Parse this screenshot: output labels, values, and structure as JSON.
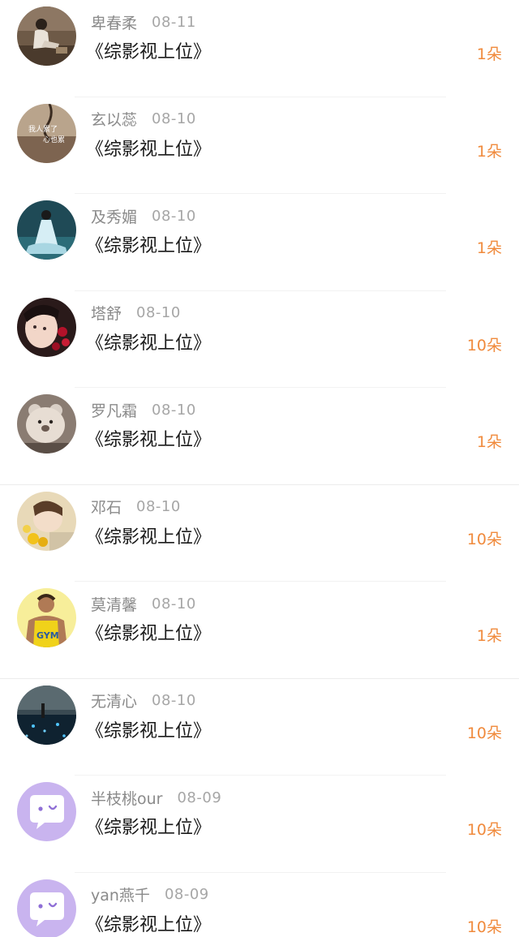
{
  "rows": [
    {
      "name": "卑春柔",
      "date": "08-11",
      "title": "《综影视上位》",
      "count": "1朵",
      "avatar": "girl-sitting-photo",
      "divider": "inset"
    },
    {
      "name": "玄以蕊",
      "date": "08-10",
      "title": "《综影视上位》",
      "count": "1朵",
      "avatar": "text-photo",
      "avatar_text": "我人累了 心也累",
      "divider": "inset"
    },
    {
      "name": "及秀媚",
      "date": "08-10",
      "title": "《综影视上位》",
      "count": "1朵",
      "avatar": "blue-dress-photo",
      "divider": "inset"
    },
    {
      "name": "塔舒",
      "date": "08-10",
      "title": "《综影视上位》",
      "count": "10朵",
      "avatar": "face-roses-photo",
      "divider": "inset"
    },
    {
      "name": "罗凡霜",
      "date": "08-10",
      "title": "《综影视上位》",
      "count": "1朵",
      "avatar": "bear-photo",
      "divider": "full"
    },
    {
      "name": "邓石",
      "date": "08-10",
      "title": "《综影视上位》",
      "count": "10朵",
      "avatar": "girl-flowers-photo",
      "divider": "inset"
    },
    {
      "name": "莫清馨",
      "date": "08-10",
      "title": "《综影视上位》",
      "count": "1朵",
      "avatar": "gym-man-photo",
      "avatar_text": "GYM",
      "divider": "full"
    },
    {
      "name": "无清心",
      "date": "08-10",
      "title": "《综影视上位》",
      "count": "10朵",
      "avatar": "night-water-photo",
      "divider": "inset"
    },
    {
      "name": "半枝桃our",
      "date": "08-09",
      "title": "《综影视上位》",
      "count": "10朵",
      "avatar": "default-chat-avatar",
      "divider": "inset"
    },
    {
      "name": "yan燕千",
      "date": "08-09",
      "title": "《综影视上位》",
      "count": "10朵",
      "avatar": "default-chat-avatar",
      "divider": "none"
    }
  ],
  "colors": {
    "count": "#f08a3c",
    "name": "#8a8a8a",
    "date": "#a6a6a6",
    "title": "#1a1a1a",
    "default_avatar": "#c9b4ef"
  }
}
